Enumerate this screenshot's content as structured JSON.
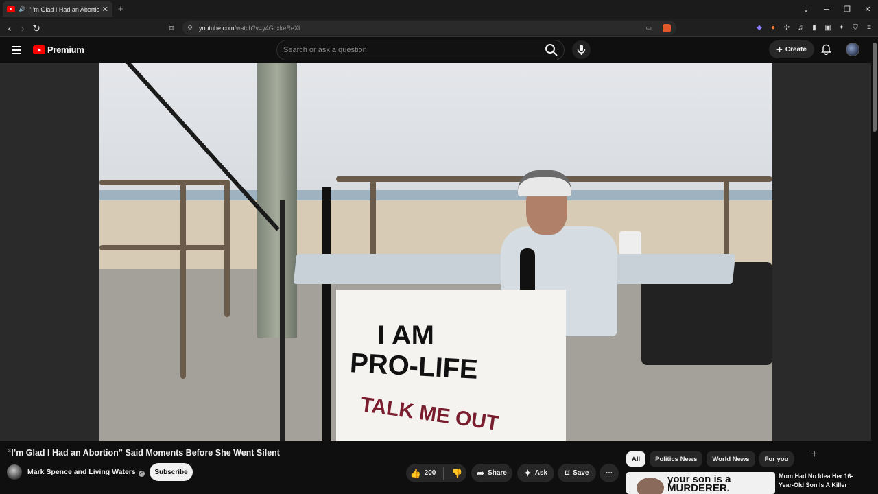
{
  "browser": {
    "tab_title": "\"I'm Glad I Had an Abortion\"",
    "new_tab": "+",
    "url_domain": "youtube.com",
    "url_path": "/watch?v=y4GcxkeReXI"
  },
  "youtube": {
    "logo_text": "Premium",
    "search_placeholder": "Search or ask a question",
    "create_label": "Create"
  },
  "video": {
    "banner_line1": "I AM",
    "banner_line2": "PRO-LIFE",
    "banner_line3": "TALK ME OUT"
  },
  "details": {
    "title": "“I’m Glad I Had an Abortion” Said Moments Before She Went Silent",
    "channel": "Mark Spence and Living Waters",
    "subscribe": "Subscribe",
    "likes": "200",
    "share": "Share",
    "ask": "Ask",
    "save": "Save",
    "more": "⋯"
  },
  "sidebar": {
    "chips": [
      "All",
      "Politics News",
      "World News",
      "For you"
    ],
    "active_chip": "All",
    "first_video": {
      "thumb_text": "your son is a MURDERER.",
      "title": "Mom Had No Idea Her 16-Year-Old Son Is A Killer"
    }
  },
  "colors": {
    "accent": "#ff0000",
    "background": "#0f0f0f",
    "chip_bg": "#272727"
  }
}
